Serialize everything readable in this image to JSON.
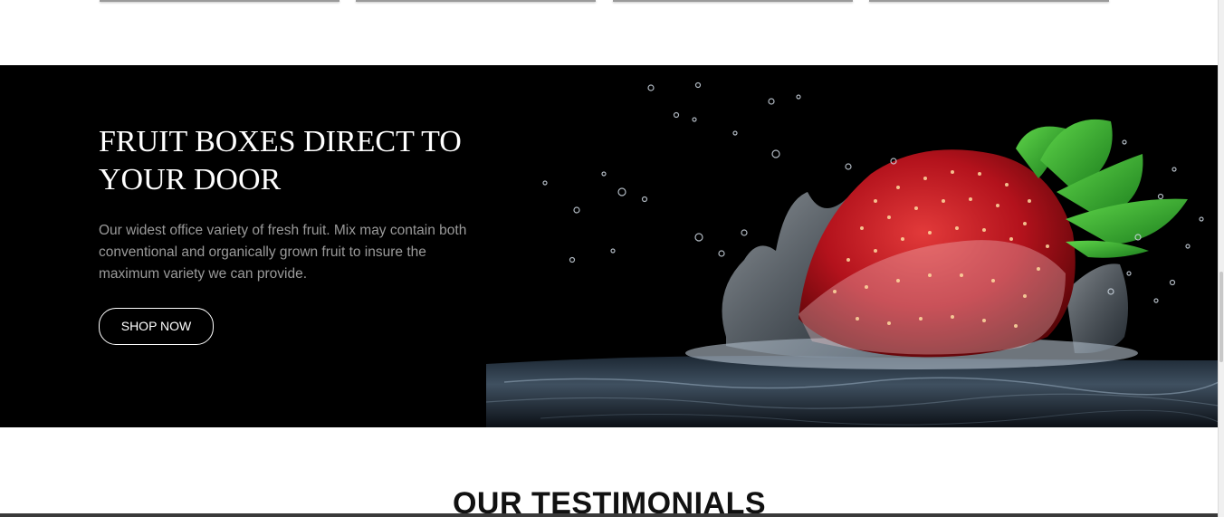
{
  "hero": {
    "title": "FRUIT BOXES DIRECT TO YOUR DOOR",
    "description": "Our widest office variety of fresh fruit. Mix may contain both conventional and organically grown fruit to insure the maximum variety we can provide.",
    "button_label": "SHOP NOW",
    "image_subject": "strawberry-water-splash",
    "background_color": "#000000"
  },
  "testimonials": {
    "heading": "OUR TESTIMONIALS"
  },
  "colors": {
    "heading_white": "#ffffff",
    "body_text_gray": "#9a9a9a",
    "strawberry_red": "#b3121c",
    "leaf_green": "#2ea82a"
  }
}
